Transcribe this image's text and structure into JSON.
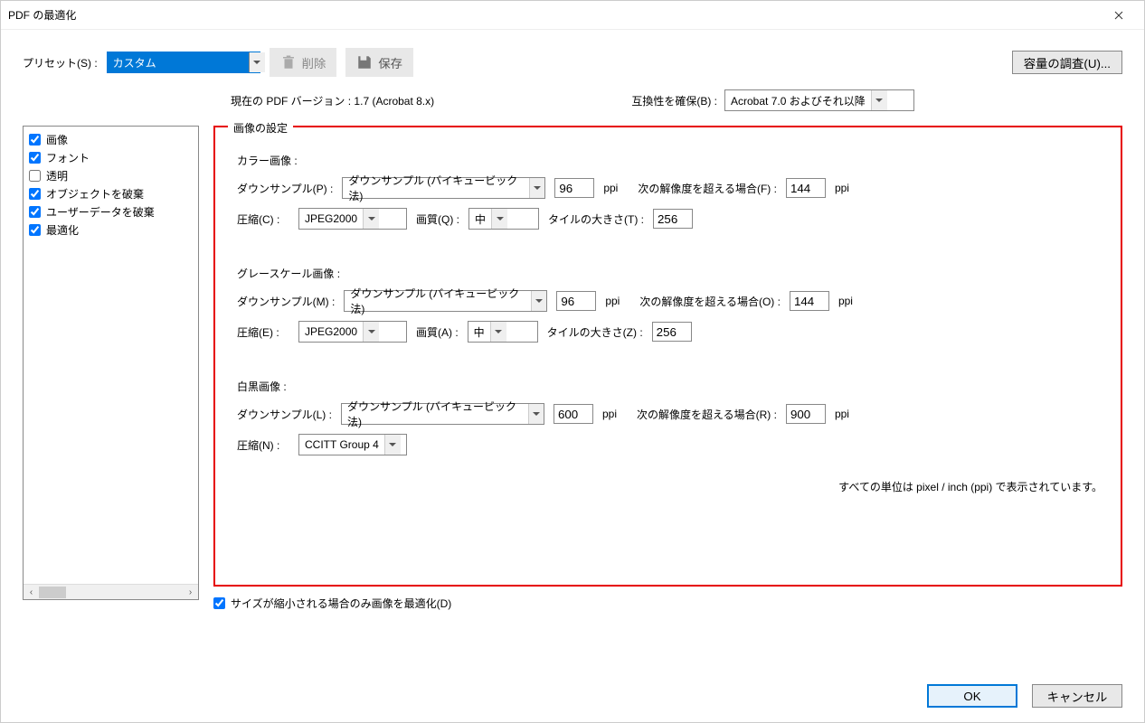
{
  "window": {
    "title": "PDF の最適化"
  },
  "toolbar": {
    "preset_label": "プリセット(S) :",
    "preset_value": "カスタム",
    "delete_label": "削除",
    "save_label": "保存",
    "audit_label": "容量の調査(U)..."
  },
  "version": {
    "text": "現在の PDF バージョン : 1.7 (Acrobat 8.x)",
    "compat_label": "互換性を確保(B) :",
    "compat_value": "Acrobat 7.0 およびそれ以降"
  },
  "categories": [
    {
      "label": "画像",
      "checked": true
    },
    {
      "label": "フォント",
      "checked": true
    },
    {
      "label": "透明",
      "checked": false
    },
    {
      "label": "オブジェクトを破棄",
      "checked": true
    },
    {
      "label": "ユーザーデータを破棄",
      "checked": true
    },
    {
      "label": "最適化",
      "checked": true
    }
  ],
  "group": {
    "title": "画像の設定",
    "color": {
      "heading": "カラー画像 :",
      "downsample_label": "ダウンサンプル(P) :",
      "downsample_method": "ダウンサンプル (バイキュービック法)",
      "ppi_value": "96",
      "ppi_unit": "ppi",
      "if_above_label": "次の解像度を超える場合(F) :",
      "if_above_value": "144",
      "if_above_unit": "ppi",
      "compress_label": "圧縮(C) :",
      "compress_value": "JPEG2000",
      "quality_label": "画質(Q) :",
      "quality_value": "中",
      "tile_label": "タイルの大きさ(T) :",
      "tile_value": "256"
    },
    "gray": {
      "heading": "グレースケール画像 :",
      "downsample_label": "ダウンサンプル(M) :",
      "downsample_method": "ダウンサンプル (バイキュービック法)",
      "ppi_value": "96",
      "ppi_unit": "ppi",
      "if_above_label": "次の解像度を超える場合(O) :",
      "if_above_value": "144",
      "if_above_unit": "ppi",
      "compress_label": "圧縮(E) :",
      "compress_value": "JPEG2000",
      "quality_label": "画質(A) :",
      "quality_value": "中",
      "tile_label": "タイルの大きさ(Z) :",
      "tile_value": "256"
    },
    "mono": {
      "heading": "白黒画像 :",
      "downsample_label": "ダウンサンプル(L) :",
      "downsample_method": "ダウンサンプル (バイキュービック法)",
      "ppi_value": "600",
      "ppi_unit": "ppi",
      "if_above_label": "次の解像度を超える場合(R) :",
      "if_above_value": "900",
      "if_above_unit": "ppi",
      "compress_label": "圧縮(N) :",
      "compress_value": "CCITT Group 4"
    },
    "note": "すべての単位は pixel / inch (ppi) で表示されています。",
    "optimize_only_smaller": "サイズが縮小される場合のみ画像を最適化(D)"
  },
  "footer": {
    "ok": "OK",
    "cancel": "キャンセル"
  }
}
